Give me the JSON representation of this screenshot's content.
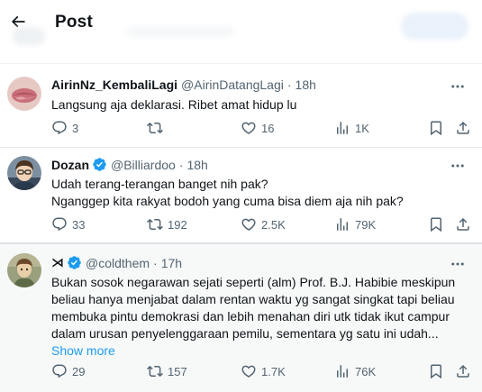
{
  "header": {
    "title": "Post"
  },
  "tweets": [
    {
      "name": "AirinNz_KembaliLagi",
      "handle": "@AirinDatangLagi",
      "time": "18h",
      "verified": false,
      "lines": [
        "Langsung aja deklarasi. Ribet amat hidup lu"
      ],
      "show_more": "",
      "replies": "3",
      "retweets": "",
      "likes": "16",
      "views": "1K"
    },
    {
      "name": "Dozan",
      "handle": "@Billiardoo",
      "time": "18h",
      "verified": true,
      "lines": [
        "Udah terang-terangan banget nih pak?",
        "Nganggep kita rakyat bodoh yang cuma bisa diem aja nih pak?"
      ],
      "show_more": "",
      "replies": "33",
      "retweets": "192",
      "likes": "2.5K",
      "views": "79K"
    },
    {
      "name": "⋊",
      "handle": "@coldthem",
      "time": "17h",
      "verified": true,
      "lines": [
        "Bukan sosok negarawan sejati seperti (alm) Prof. B.J. Habibie meskipun",
        "beliau hanya menjabat dalam rentan waktu yg sangat singkat tapi beliau",
        "membuka pintu demokrasi dan lebih menahan diri utk tidak ikut campur",
        "dalam urusan penyelenggaraan pemilu, sementara yg satu ini udah..."
      ],
      "show_more": "Show more",
      "replies": "29",
      "retweets": "157",
      "likes": "1.7K",
      "views": "76K"
    }
  ],
  "icons": {
    "back": "arrow-left-icon",
    "more": "more-horizontal-icon",
    "reply": "reply-icon",
    "retweet": "retweet-icon",
    "like": "heart-icon",
    "views": "views-chart-icon",
    "bookmark": "bookmark-icon",
    "share": "share-icon",
    "verified": "verified-badge-icon"
  },
  "colors": {
    "accent": "#1d9bf0",
    "text": "#0f1419",
    "muted": "#536471"
  }
}
